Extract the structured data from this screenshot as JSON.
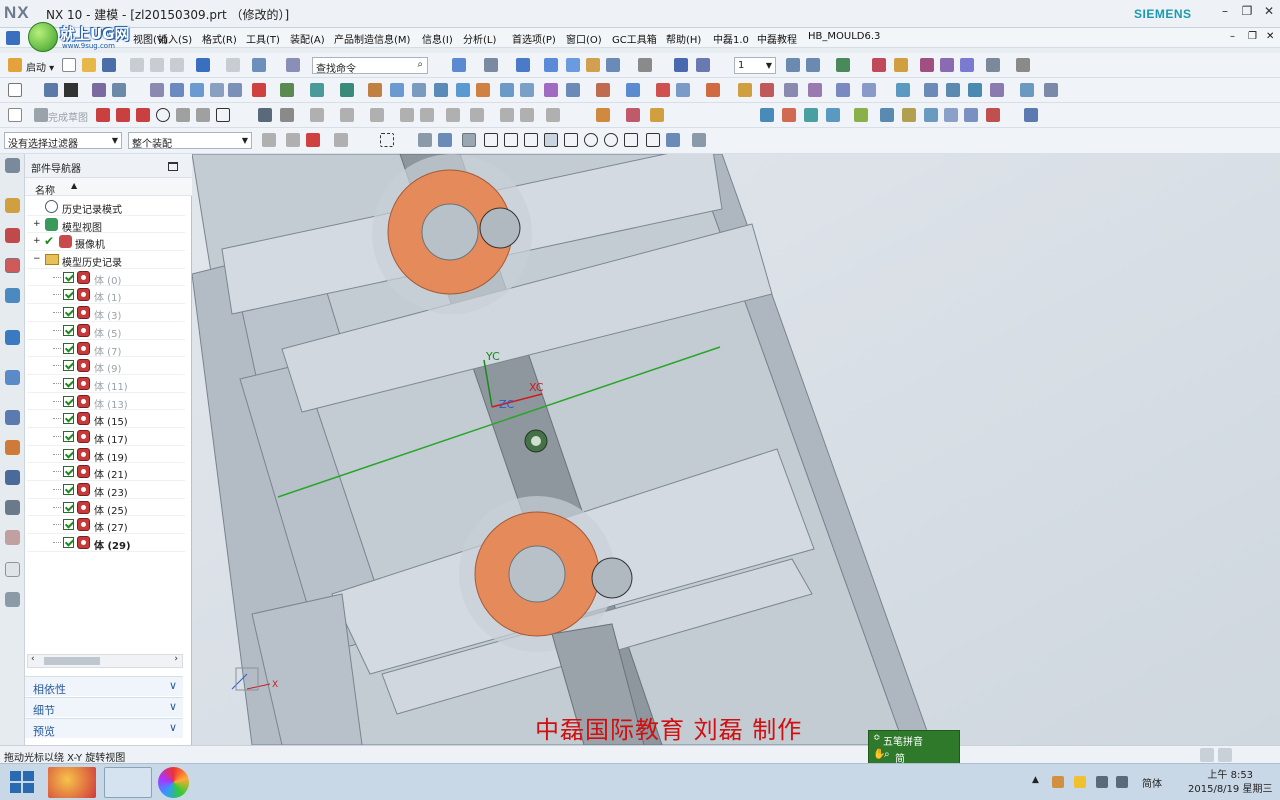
{
  "window": {
    "logo": "NX",
    "title": "NX 10 - 建模 - [zl20150309.prt （修改的）]",
    "brand": "SIEMENS",
    "controls": [
      "–",
      "❐",
      "✕"
    ],
    "doc_controls": [
      "–",
      "❐",
      "✕"
    ]
  },
  "watermark": {
    "text": "就上UG网",
    "sub": "www.9sug.com"
  },
  "menubar": {
    "items": [
      "视图(V)",
      "插入(S)",
      "格式(R)",
      "工具(T)",
      "装配(A)",
      "产品制造信息(M)",
      "信息(I)",
      "分析(L)",
      "首选项(P)",
      "窗口(O)",
      "GC工具箱",
      "帮助(H)",
      "中磊1.0",
      "中磊教程",
      "HB_MOULD6.3"
    ]
  },
  "toolbar1": {
    "start_label": "启动 ▾",
    "search_placeholder": "查找命令",
    "layer_value": "1"
  },
  "toolbar3": {
    "finish_sketch": "完成草图"
  },
  "selection_bar": {
    "filter_value": "没有选择过滤器",
    "scope_value": "整个装配"
  },
  "navigator": {
    "title": "部件导航器",
    "column_name": "名称",
    "items": [
      {
        "label": "历史记录模式",
        "kind": "mode"
      },
      {
        "label": "模型视图",
        "kind": "view"
      },
      {
        "label": "摄像机",
        "kind": "camera"
      },
      {
        "label": "模型历史记录",
        "kind": "folder"
      }
    ],
    "features": [
      {
        "label": "体 (0)",
        "state": "greyed"
      },
      {
        "label": "体 (1)",
        "state": "greyed"
      },
      {
        "label": "体 (3)",
        "state": "greyed"
      },
      {
        "label": "体 (5)",
        "state": "greyed"
      },
      {
        "label": "体 (7)",
        "state": "greyed"
      },
      {
        "label": "体 (9)",
        "state": "greyed"
      },
      {
        "label": "体 (11)",
        "state": "greyed"
      },
      {
        "label": "体 (13)",
        "state": "greyed"
      },
      {
        "label": "体 (15)",
        "state": "normal"
      },
      {
        "label": "体 (17)",
        "state": "normal"
      },
      {
        "label": "体 (19)",
        "state": "normal"
      },
      {
        "label": "体 (21)",
        "state": "normal"
      },
      {
        "label": "体 (23)",
        "state": "normal"
      },
      {
        "label": "体 (25)",
        "state": "normal"
      },
      {
        "label": "体 (27)",
        "state": "normal"
      },
      {
        "label": "体 (29)",
        "state": "bold"
      }
    ],
    "sections": [
      "相依性",
      "细节",
      "预览"
    ]
  },
  "graphics": {
    "axis_labels": {
      "yc": "YC",
      "xc": "XC",
      "zc": "ZC"
    },
    "triad_x": "X",
    "colors": {
      "part": "#c2cad2",
      "slot": "#8e969e",
      "orange": "#e58a5a",
      "wcs_line": "#2aa52a",
      "xc": "#d01a1a",
      "yc": "#1a8a1a",
      "zc": "#2a5ad0"
    }
  },
  "status": {
    "text": "拖动光标以绕 X-Y 旋转视图"
  },
  "ime": {
    "line1": "五笔拼音",
    "line2": "简"
  },
  "banner": {
    "text": "中磊国际教育 刘磊 制作"
  },
  "taskbar": {
    "tray_lang": "简体",
    "time": "上午 8:53",
    "date": "2015/8/19 星期三"
  }
}
